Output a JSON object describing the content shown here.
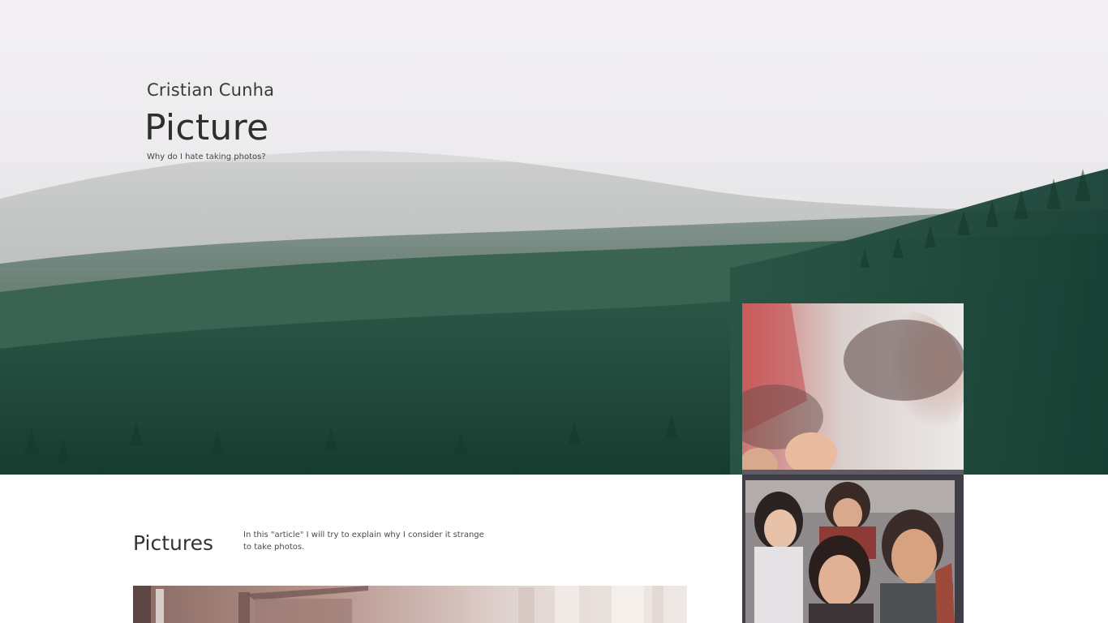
{
  "hero": {
    "author": "Cristian Cunha",
    "title": "Picture",
    "subtitle": "Why do I hate taking photos?"
  },
  "section": {
    "title": "Pictures",
    "description": "In this \"article\" I will try to explain why I consider it strange to take photos."
  },
  "images": {
    "hero_background": "misty-forest-mountain-photo",
    "photo_card": "group-selfie-polaroid-photo",
    "bottom_photo": "building-facade-photo"
  }
}
